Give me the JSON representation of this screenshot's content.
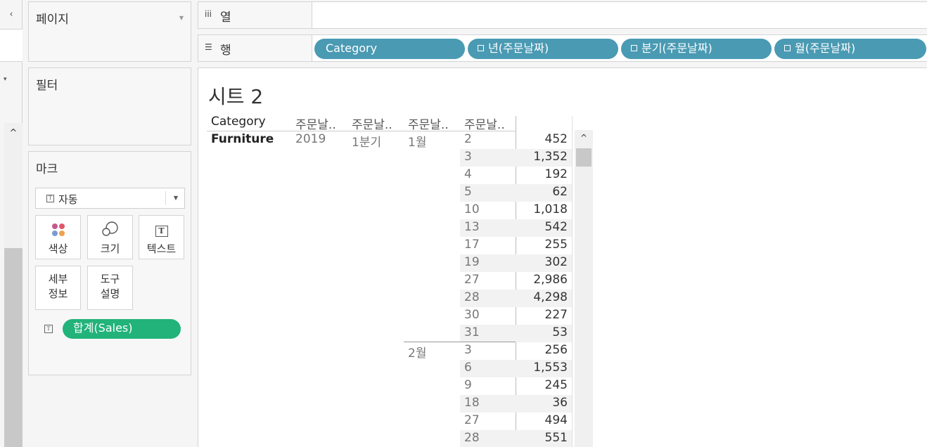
{
  "left_strip": {
    "collapse_icon": "‹",
    "dropdown_icon": "▾",
    "scroll_up_icon": "^"
  },
  "cards": {
    "pages_title": "페이지",
    "filters_title": "필터",
    "marks_title": "마크"
  },
  "marks": {
    "type_label": "자동",
    "buttons": {
      "color": "색상",
      "size": "크기",
      "text": "텍스트",
      "detail": "세부\n정보",
      "tooltip": "도구\n설명"
    },
    "detail_line1": "세부",
    "detail_line2": "정보",
    "tooltip_line1": "도구",
    "tooltip_line2": "설명",
    "sales_pill": "합계(Sales)",
    "dot_colors": [
      "#c45a8a",
      "#e0566a",
      "#7b9bd0",
      "#f0a050"
    ]
  },
  "shelves": {
    "columns_label": "열",
    "rows_label": "행",
    "row_pills": [
      "Category",
      "년(주문날짜)",
      "분기(주문날짜)",
      "월(주문날짜)"
    ]
  },
  "view": {
    "title": "시트 2",
    "headers": [
      "Category",
      "주문날..",
      "주문날..",
      "주문날..",
      "주문날.."
    ],
    "category": "Furniture",
    "year": "2019",
    "quarter": "1분기",
    "months": [
      {
        "label": "1월",
        "rows": [
          {
            "day": "2",
            "value": "452"
          },
          {
            "day": "3",
            "value": "1,352"
          },
          {
            "day": "4",
            "value": "192"
          },
          {
            "day": "5",
            "value": "62"
          },
          {
            "day": "10",
            "value": "1,018"
          },
          {
            "day": "13",
            "value": "542"
          },
          {
            "day": "17",
            "value": "255"
          },
          {
            "day": "19",
            "value": "302"
          },
          {
            "day": "27",
            "value": "2,986"
          },
          {
            "day": "28",
            "value": "4,298"
          },
          {
            "day": "30",
            "value": "227"
          },
          {
            "day": "31",
            "value": "53"
          }
        ]
      },
      {
        "label": "2월",
        "rows": [
          {
            "day": "3",
            "value": "256"
          },
          {
            "day": "6",
            "value": "1,553"
          },
          {
            "day": "9",
            "value": "245"
          },
          {
            "day": "18",
            "value": "36"
          },
          {
            "day": "27",
            "value": "494"
          },
          {
            "day": "28",
            "value": "551"
          }
        ]
      }
    ]
  },
  "colors": {
    "pill_blue": "#4a9ab3",
    "pill_green": "#22b37a"
  }
}
